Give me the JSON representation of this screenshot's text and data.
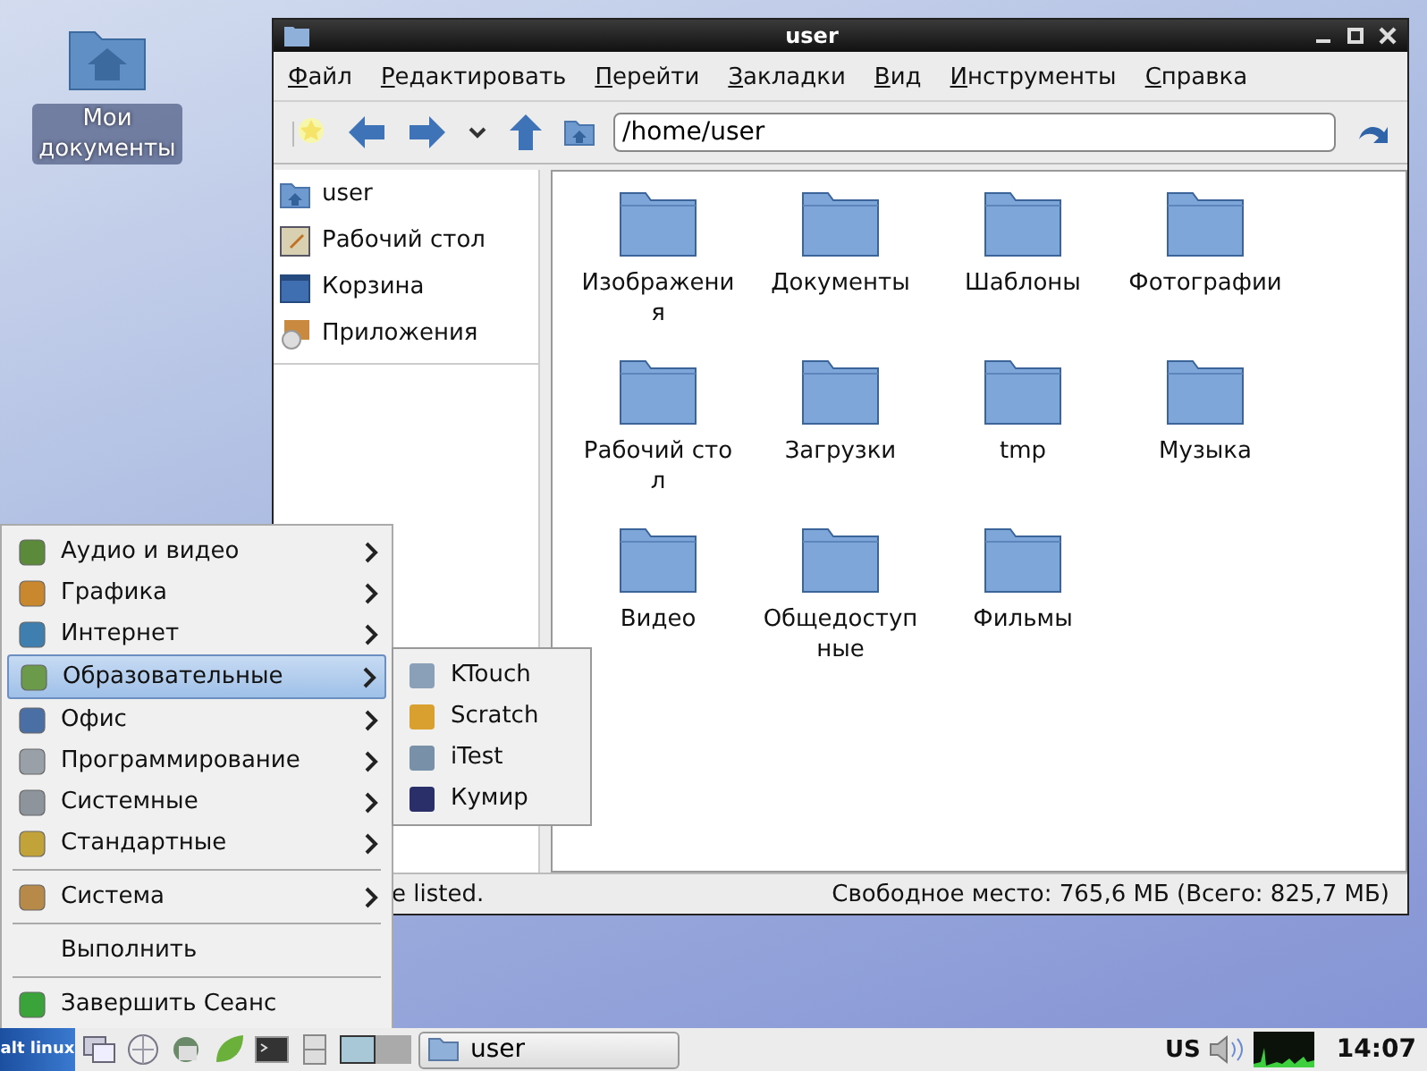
{
  "desktop_icons": [
    {
      "label": "Мои документы"
    }
  ],
  "window": {
    "title": "user",
    "menu": [
      "Файл",
      "Редактировать",
      "Перейти",
      "Закладки",
      "Вид",
      "Инструменты",
      "Справка"
    ],
    "path": "/home/user",
    "sidebar": [
      {
        "label": "user"
      },
      {
        "label": "Рабочий стол"
      },
      {
        "label": "Корзина"
      },
      {
        "label": "Приложения"
      }
    ],
    "folders": [
      {
        "label": "Изображения"
      },
      {
        "label": "Документы"
      },
      {
        "label": "Шаблоны"
      },
      {
        "label": "Фотографии"
      },
      {
        "label": "Рабочий стол"
      },
      {
        "label": "Загрузки"
      },
      {
        "label": "tmp"
      },
      {
        "label": "Музыка"
      },
      {
        "label": "Видео"
      },
      {
        "label": "Общедоступные"
      },
      {
        "label": "Фильмы"
      }
    ],
    "status_bar": {
      "left": "e listed.",
      "right": "Свободное место: 765,6 МБ (Всего: 825,7 МБ)"
    }
  },
  "start_menu": {
    "sections": [
      {
        "items": [
          {
            "label": "Аудио и видео",
            "kind": "submenu",
            "selected": false
          },
          {
            "label": "Графика",
            "kind": "submenu",
            "selected": false
          },
          {
            "label": "Интернет",
            "kind": "submenu",
            "selected": false
          },
          {
            "label": "Образовательные",
            "kind": "submenu",
            "selected": true
          },
          {
            "label": "Офис",
            "kind": "submenu",
            "selected": false
          },
          {
            "label": "Программирование",
            "kind": "submenu",
            "selected": false
          },
          {
            "label": "Системные",
            "kind": "submenu",
            "selected": false
          },
          {
            "label": "Стандартные",
            "kind": "submenu",
            "selected": false
          }
        ]
      },
      {
        "items": [
          {
            "label": "Система",
            "kind": "submenu",
            "selected": false
          }
        ]
      },
      {
        "items": [
          {
            "label": "Выполнить",
            "kind": "action",
            "selected": false
          }
        ]
      },
      {
        "items": [
          {
            "label": "Завершить Сеанс",
            "kind": "action",
            "selected": false
          }
        ]
      }
    ]
  },
  "submenu": {
    "items": [
      {
        "label": "KTouch",
        "selected": false
      },
      {
        "label": "Scratch",
        "selected": false
      },
      {
        "label": "iTest",
        "selected": false
      },
      {
        "label": "Кумир",
        "selected": false
      }
    ]
  },
  "taskbar": {
    "logo": "alt linux",
    "desktops": [
      {
        "selected": true
      },
      {
        "selected": false
      }
    ],
    "tasks": [
      {
        "label": "user"
      }
    ],
    "keyboard_layout": "US",
    "clock": "14:07"
  }
}
